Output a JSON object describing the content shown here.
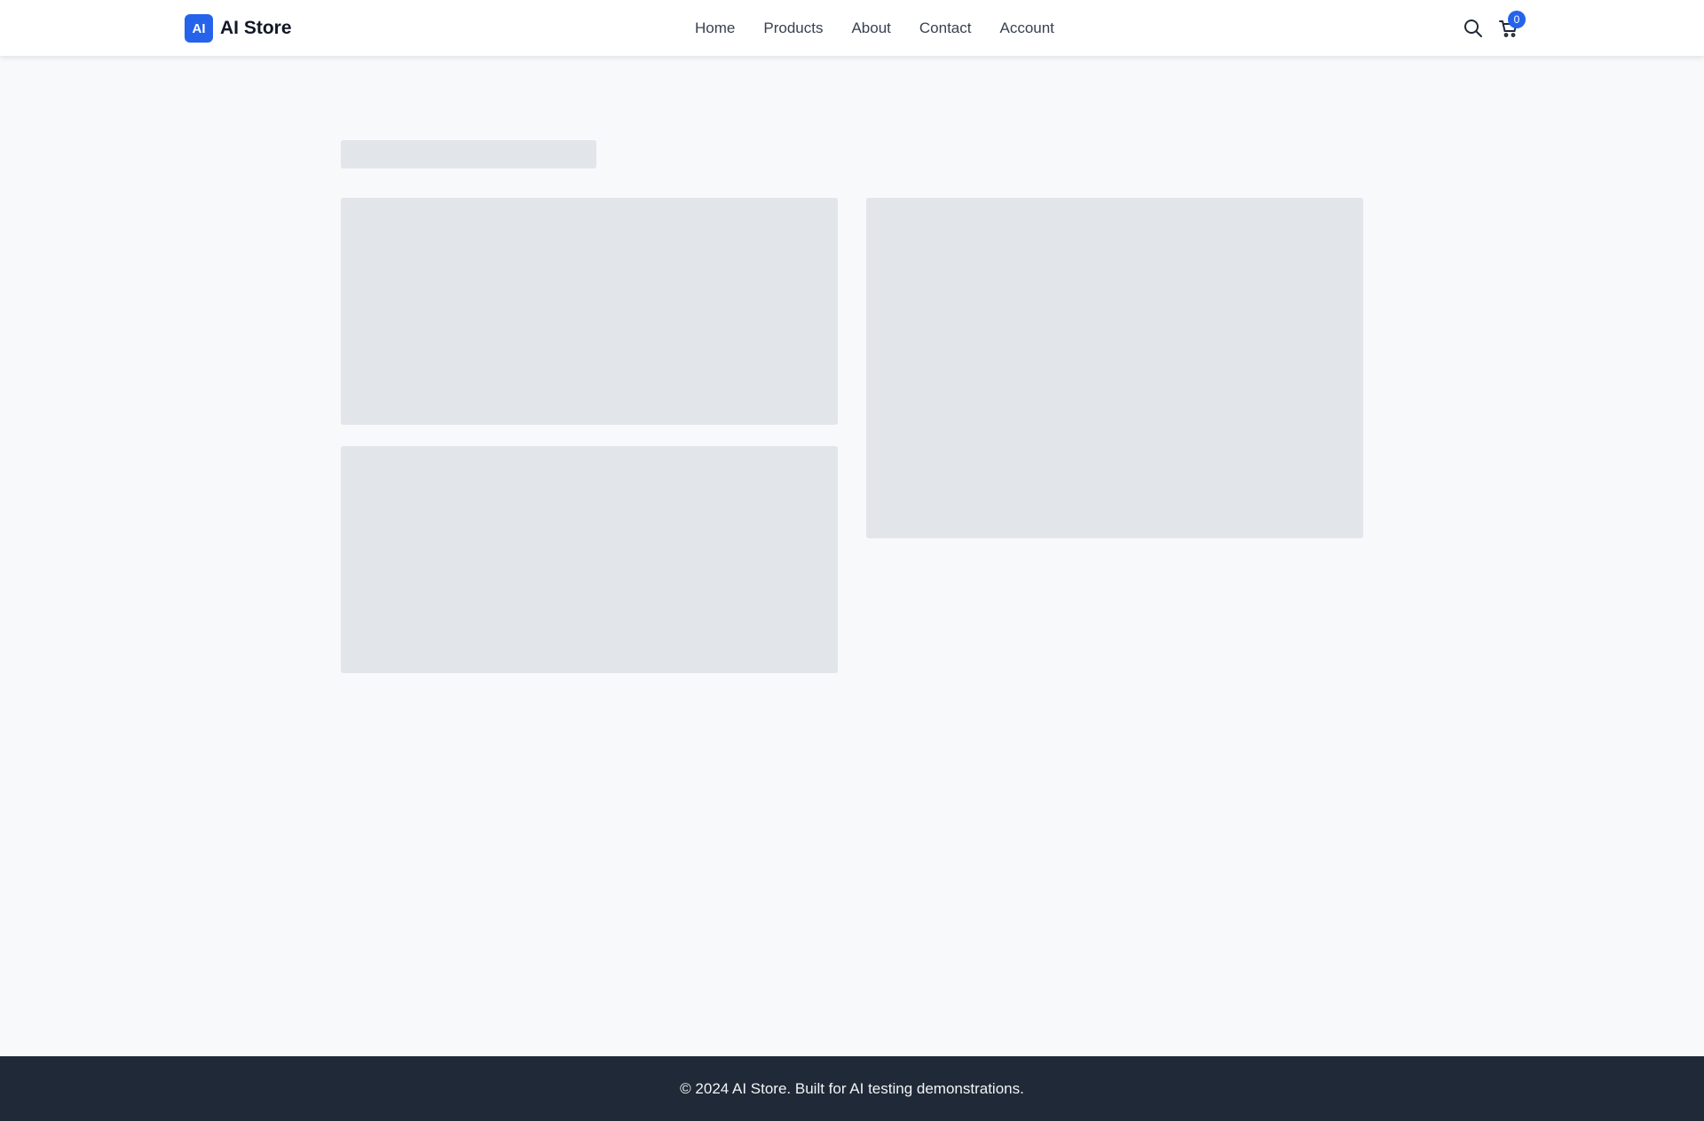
{
  "brand": {
    "badge": "AI",
    "name": "AI Store",
    "accent_color": "#2563eb"
  },
  "nav": {
    "items": [
      {
        "label": "Home"
      },
      {
        "label": "Products"
      },
      {
        "label": "About"
      },
      {
        "label": "Contact"
      },
      {
        "label": "Account"
      }
    ]
  },
  "header_actions": {
    "search_icon": "search-icon",
    "cart_icon": "cart-icon",
    "cart_count": "0"
  },
  "footer": {
    "text": "© 2024 AI Store. Built for AI testing demonstrations.",
    "background": "#1f2937"
  },
  "colors": {
    "page_background": "#f8f9fb",
    "skeleton": "#e2e5ea"
  }
}
